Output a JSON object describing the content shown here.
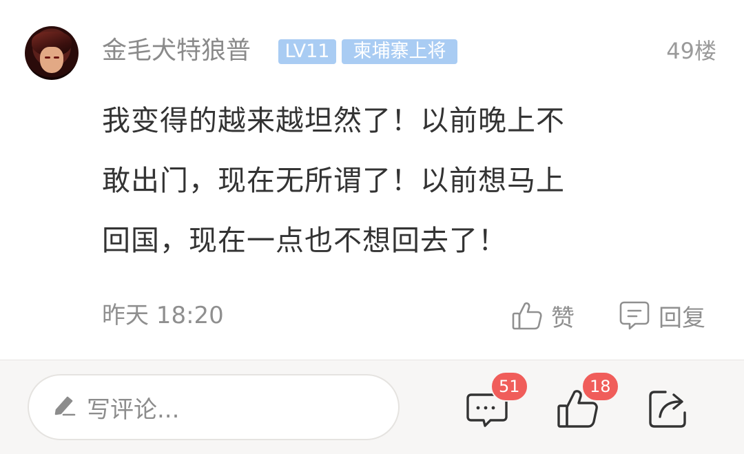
{
  "post": {
    "username": "金毛犬特狼普",
    "level_badge": "LV11",
    "title_badge": "柬埔寨上将",
    "floor": "49楼",
    "content_lines": [
      "我变得的越来越坦然了！以前晚上不",
      "敢出门，现在无所谓了！以前想马上",
      "回国，现在一点也不想回去了！"
    ],
    "time": "昨天 18:20",
    "like_label": "赞",
    "reply_label": "回复"
  },
  "bottom_bar": {
    "comment_placeholder": "写评论...",
    "comments_count": "51",
    "likes_count": "18"
  },
  "colors": {
    "badge_bg": "#a9ccf3",
    "count_badge_bg": "#f05d5a",
    "text_primary": "#333333",
    "text_secondary": "#8f8f8f",
    "bottom_bar_bg": "#f7f6f5"
  },
  "icons": {
    "like": "thumbs-up-icon",
    "reply": "chat-bubble-icon",
    "pencil": "pencil-icon",
    "comments": "comment-icon",
    "likes": "thumbs-up-icon",
    "share": "share-icon"
  }
}
